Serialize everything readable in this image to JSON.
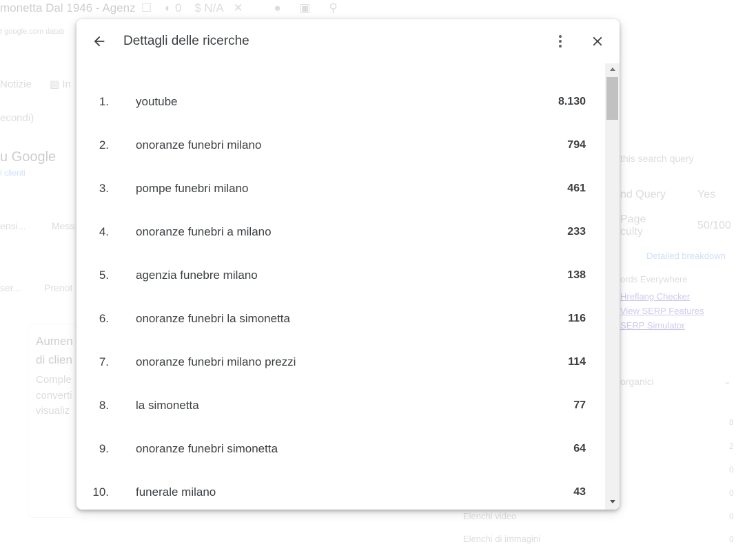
{
  "background": {
    "title": "monetta Dal 1946 - Agenz",
    "url": "t google.com  datab",
    "counter": "0",
    "rating": "N/A",
    "tab_notizie": "Notizie",
    "tab_images_partial": "In",
    "secondi": "econdi)",
    "su_google": "u Google",
    "clienti": "i clienti",
    "btn_ensi": "ensi...",
    "btn_mess": "Mess",
    "btn_ser": "ser...",
    "btn_prenot": "Prenot",
    "card_title_1": "Aumen",
    "card_title_2": "di clien",
    "card_text_1": "Comple",
    "card_text_2": "converti",
    "card_text_3": "visualiz",
    "this_search_query": "this search query",
    "nd_query": "nd Query",
    "nd_query_value": "Yes",
    "page_label_1": "Page",
    "page_label_2": "culty",
    "difficulty_value": "50/100",
    "detailed_breakdown": "Detailed breakdown",
    "keywords_everywhere": "ords Everywhere",
    "hreflang_checker": "Hreflang Checker",
    "view_serp_features": "View SERP Features",
    "serp_simulator": "SERP Simulator",
    "organici": "organici",
    "elenchi_video": "Elenchi video",
    "elenchi_immagini": "Elenchi di immagini",
    "side_numbers": [
      "8",
      "2",
      "0",
      "0",
      "0",
      "0"
    ]
  },
  "dialog": {
    "title": "Dettagli delle ricerche",
    "rows": [
      {
        "rank": "1.",
        "query": "youtube",
        "count": "8.130"
      },
      {
        "rank": "2.",
        "query": "onoranze funebri milano",
        "count": "794"
      },
      {
        "rank": "3.",
        "query": "pompe funebri milano",
        "count": "461"
      },
      {
        "rank": "4.",
        "query": "onoranze funebri a milano",
        "count": "233"
      },
      {
        "rank": "5.",
        "query": "agenzia funebre milano",
        "count": "138"
      },
      {
        "rank": "6.",
        "query": "onoranze funebri la simonetta",
        "count": "116"
      },
      {
        "rank": "7.",
        "query": "onoranze funebri milano prezzi",
        "count": "114"
      },
      {
        "rank": "8.",
        "query": "la simonetta",
        "count": "77"
      },
      {
        "rank": "9.",
        "query": "onoranze funebri simonetta",
        "count": "64"
      },
      {
        "rank": "10.",
        "query": "funerale milano",
        "count": "43"
      }
    ]
  },
  "icons": {
    "back": "arrow-back-icon",
    "more": "more-vert-icon",
    "close": "close-icon"
  },
  "colors": {
    "text": "#3c4043",
    "icon": "#5f6368",
    "scroll_track": "#f1f1f1",
    "scroll_thumb": "#c1c1c1"
  }
}
